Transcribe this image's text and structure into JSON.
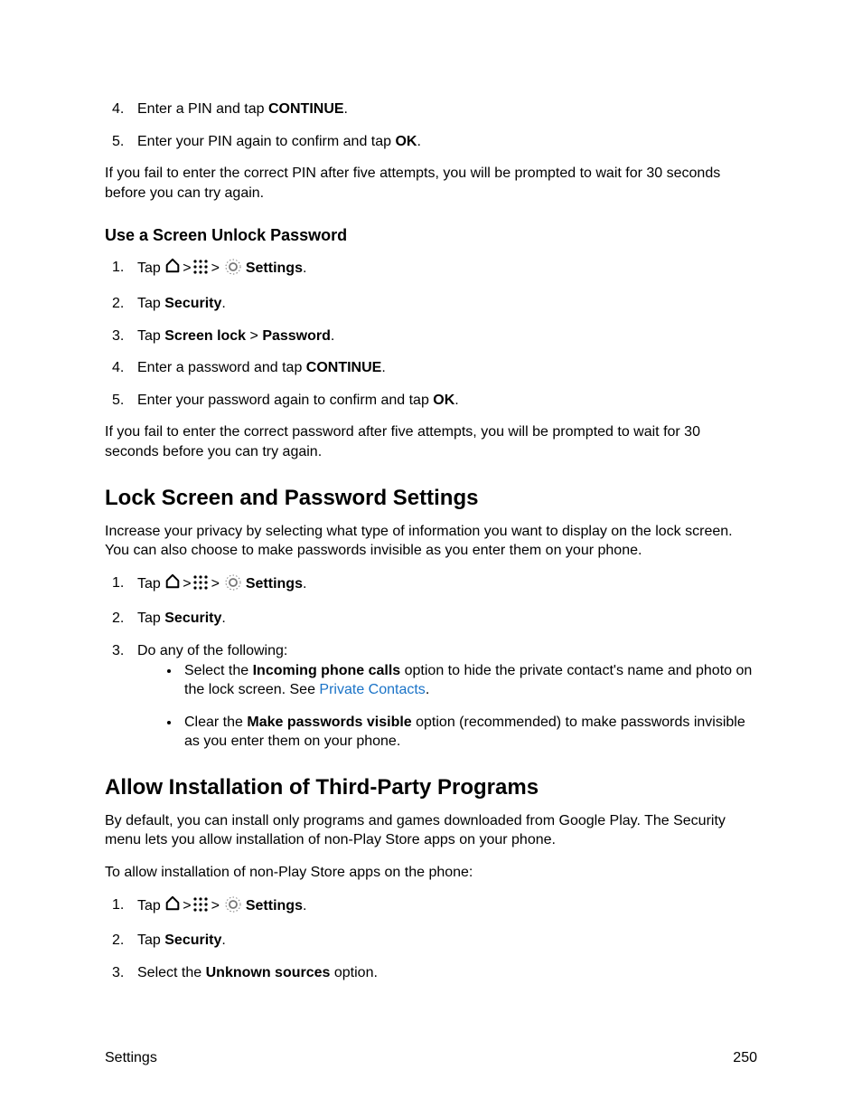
{
  "pin_steps": {
    "step4_a": "Enter a PIN and tap ",
    "step4_b": "CONTINUE",
    "step4_c": ".",
    "step5_a": "Enter your PIN again to confirm and tap ",
    "step5_b": "OK",
    "step5_c": "."
  },
  "pin_fail": "If you fail to enter the correct PIN after five attempts, you will be prompted to wait for 30 seconds before you can try again.",
  "heading_pw": "Use a Screen Unlock Password",
  "tap_prefix": "Tap ",
  "gt": ">",
  "settings_label": "Settings",
  "period": ".",
  "pw_steps": {
    "s2a": "Tap ",
    "s2b": "Security",
    "s3a": "Tap ",
    "s3b": "Screen lock",
    "s3c": " > ",
    "s3d": "Password",
    "s4a": "Enter a password and tap ",
    "s4b": "CONTINUE",
    "s5a": "Enter your password again to confirm and tap ",
    "s5b": "OK"
  },
  "pw_fail": "If you fail to enter the correct password after five attempts, you will be prompted to wait for 30 seconds before you can try again.",
  "heading_lock": "Lock Screen and Password Settings",
  "lock_intro": "Increase your privacy by selecting what type of information you want to display on the lock screen. You can also choose to make passwords invisible as you enter them on your phone.",
  "lock_steps": {
    "s3": "Do any of the following:",
    "b1a": "Select the ",
    "b1b": "Incoming phone calls",
    "b1c": " option to hide the private contact's name and photo on the lock screen. See ",
    "b1d": "Private Contacts",
    "b1e": ".",
    "b2a": "Clear the ",
    "b2b": "Make passwords visible",
    "b2c": " option (recommended) to make passwords invisible as you enter them on your phone."
  },
  "heading_third": "Allow Installation of Third-Party Programs",
  "third_intro": "By default, you can install only programs and games downloaded from Google Play. The Security menu lets you allow installation of non-Play Store apps on your phone.",
  "third_preface": "To allow installation of non-Play Store apps on the phone:",
  "third_steps": {
    "s3a": "Select the ",
    "s3b": "Unknown sources",
    "s3c": " option."
  },
  "footer_left": "Settings",
  "footer_right": "250"
}
